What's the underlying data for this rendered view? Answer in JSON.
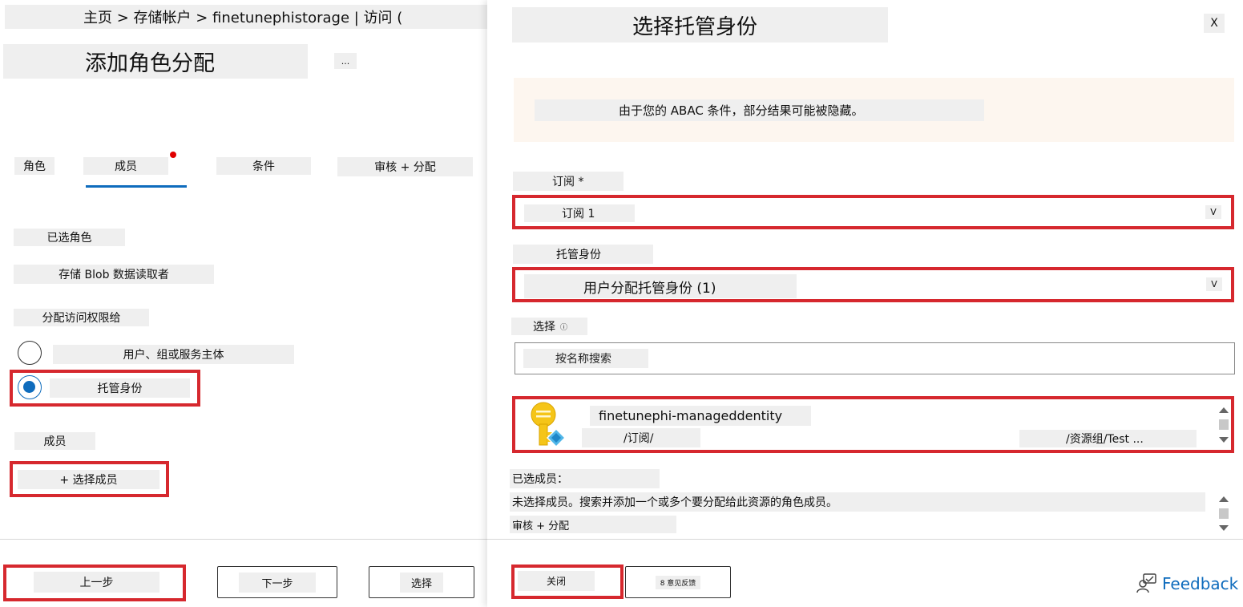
{
  "left": {
    "breadcrumb": "主页 > 存储帐户 > finetunephistorage | 访问 (",
    "title": "添加角色分配",
    "more_label": "...",
    "tabs": [
      {
        "label": "角色"
      },
      {
        "label": "成员"
      },
      {
        "label": "条件"
      },
      {
        "label": "审核 + 分配"
      }
    ],
    "selected_role_label": "已选角色",
    "selected_role_value": "存储 Blob 数据读取者",
    "assign_access_label": "分配访问权限给",
    "option_user": "用户、组或服务主体",
    "option_managed": "托管身份",
    "members_label": "成员",
    "select_members": "+ 选择成员",
    "footer": {
      "prev": "上一步",
      "next": "下一步",
      "select": "选择"
    }
  },
  "right": {
    "title": "选择托管身份",
    "close_glyph": "X",
    "notice": "由于您的 ABAC 条件，部分结果可能被隐藏。",
    "subscription_label": "订阅 *",
    "subscription_value": "订阅 1",
    "managed_identity_label": "托管身份",
    "managed_identity_value": "用户分配托管身份 (1)",
    "select_label": "选择",
    "search_placeholder": "按名称搜索",
    "dropdown_chevron": "V",
    "result": {
      "name": "finetunephi-manageddentity",
      "subscription": "/订阅/",
      "resource_group": "/资源组/Test ..."
    },
    "selected_members_label": "已选成员：",
    "no_members_text": "未选择成员。搜索并添加一个或多个要分配给此资源的角色成员。",
    "review_assign": "审核 + 分配",
    "footer": {
      "close": "关闭",
      "feedback_small": "8 意见反馈",
      "feedback": "Feedback"
    }
  },
  "colors": {
    "accent": "#0f6cbd",
    "highlight_red": "#d6282e",
    "notice_bg": "#fdf6ef",
    "key_gold": "#f5c518"
  }
}
